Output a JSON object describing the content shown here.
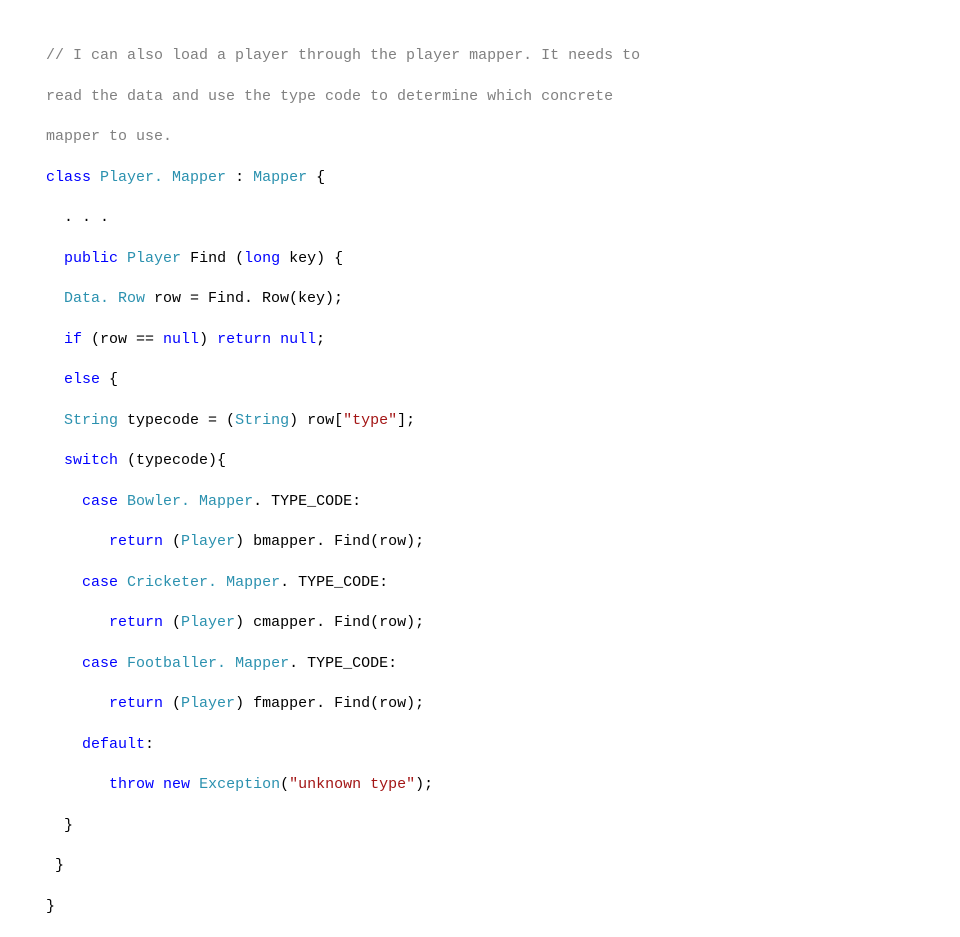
{
  "code": {
    "comment1": "// I can also load a player through the player mapper. It needs to",
    "comment2": "read the data and use the type code to determine which concrete",
    "comment3": "mapper to use.",
    "l4_class": "class",
    "l4_name": "Player. Mapper",
    "l4_colon": " : ",
    "l4_base": "Mapper",
    "l4_brace": " {",
    "l5": "  . . .",
    "l6_pre": "  ",
    "l6_public": "public",
    "l6_sp1": " ",
    "l6_type": "Player",
    "l6_sp2": " ",
    "l6_name": "Find",
    "l6_lp": " (",
    "l6_long": "long",
    "l6_key": " key) {",
    "l7_pre": "  ",
    "l7_type": "Data. Row",
    "l7_after": " row = Find. Row(key);",
    "l8_pre": "  ",
    "l8_if": "if",
    "l8_mid": " (row == ",
    "l8_null1": "null",
    "l8_mid2": ") ",
    "l8_return": "return",
    "l8_sp": " ",
    "l8_null2": "null",
    "l8_end": ";",
    "l9_pre": "  ",
    "l9_else": "else",
    "l9_brace": " {",
    "l10_pre": "  ",
    "l10_type": "String",
    "l10_mid": " typecode = (",
    "l10_cast": "String",
    "l10_mid2": ") row[",
    "l10_str": "\"type\"",
    "l10_end": "];",
    "l11_pre": "  ",
    "l11_switch": "switch",
    "l11_after": " (typecode){",
    "l12_pre": "    ",
    "l12_case": "case",
    "l12_sp": " ",
    "l12_name": "Bowler. Mapper",
    "l12_end": ". TYPE_CODE:",
    "l13_pre": "       ",
    "l13_return": "return",
    "l13_sp": " (",
    "l13_cast": "Player",
    "l13_end": ") bmapper. Find(row);",
    "l14_pre": "    ",
    "l14_case": "case",
    "l14_sp": " ",
    "l14_name": "Cricketer. Mapper",
    "l14_end": ". TYPE_CODE:",
    "l15_pre": "       ",
    "l15_return": "return",
    "l15_sp": " (",
    "l15_cast": "Player",
    "l15_end": ") cmapper. Find(row);",
    "l16_pre": "    ",
    "l16_case": "case",
    "l16_sp": " ",
    "l16_name": "Footballer. Mapper",
    "l16_end": ". TYPE_CODE:",
    "l17_pre": "       ",
    "l17_return": "return",
    "l17_sp": " (",
    "l17_cast": "Player",
    "l17_end": ") fmapper. Find(row);",
    "l18_pre": "    ",
    "l18_default": "default",
    "l18_end": ":",
    "l19_pre": "       ",
    "l19_throw": "throw",
    "l19_sp": " ",
    "l19_new": "new",
    "l19_sp2": " ",
    "l19_exc": "Exception",
    "l19_lp": "(",
    "l19_str": "\"unknown type\"",
    "l19_end": ");",
    "l20": "  }",
    "l21": " }",
    "l22": "}"
  }
}
